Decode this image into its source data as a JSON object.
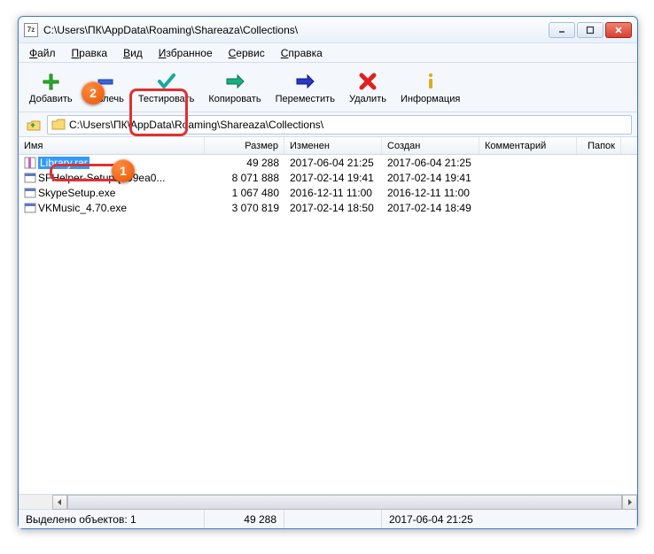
{
  "title": "C:\\Users\\ПК\\AppData\\Roaming\\Shareaza\\Collections\\",
  "app_icon_text": "7z",
  "menu": [
    "Файл",
    "Правка",
    "Вид",
    "Избранное",
    "Сервис",
    "Справка"
  ],
  "toolbar": [
    {
      "label": "Добавить",
      "icon": "plus-icon"
    },
    {
      "label": "Извлечь",
      "icon": "minus-icon"
    },
    {
      "label": "Тестировать",
      "icon": "check-icon"
    },
    {
      "label": "Копировать",
      "icon": "copy-arrow-icon"
    },
    {
      "label": "Переместить",
      "icon": "move-arrow-icon"
    },
    {
      "label": "Удалить",
      "icon": "delete-icon"
    },
    {
      "label": "Информация",
      "icon": "info-icon"
    }
  ],
  "path": "C:\\Users\\ПК\\AppData\\Roaming\\Shareaza\\Collections\\",
  "columns": {
    "name": "Имя",
    "size": "Размер",
    "modified": "Изменен",
    "created": "Создан",
    "comment": "Комментарий",
    "folders": "Папок"
  },
  "rows": [
    {
      "name": "Library.rar",
      "size": "49 288",
      "modified": "2017-06-04 21:25",
      "created": "2017-06-04 21:25",
      "selected": true,
      "type": "archive"
    },
    {
      "name": "SFHelper-Setup-[199ea0...",
      "size": "8 071 888",
      "modified": "2017-02-14 19:41",
      "created": "2017-02-14 19:41",
      "selected": false,
      "type": "exe"
    },
    {
      "name": "SkypeSetup.exe",
      "size": "1 067 480",
      "modified": "2016-12-11 11:00",
      "created": "2016-12-11 11:00",
      "selected": false,
      "type": "exe"
    },
    {
      "name": "VKMusic_4.70.exe",
      "size": "3 070 819",
      "modified": "2017-02-14 18:50",
      "created": "2017-02-14 18:49",
      "selected": false,
      "type": "exe"
    }
  ],
  "status": {
    "label": "Выделено объектов: 1",
    "size": "49 288",
    "modified": "2017-06-04 21:25"
  },
  "badges": {
    "b1": "1",
    "b2": "2"
  }
}
